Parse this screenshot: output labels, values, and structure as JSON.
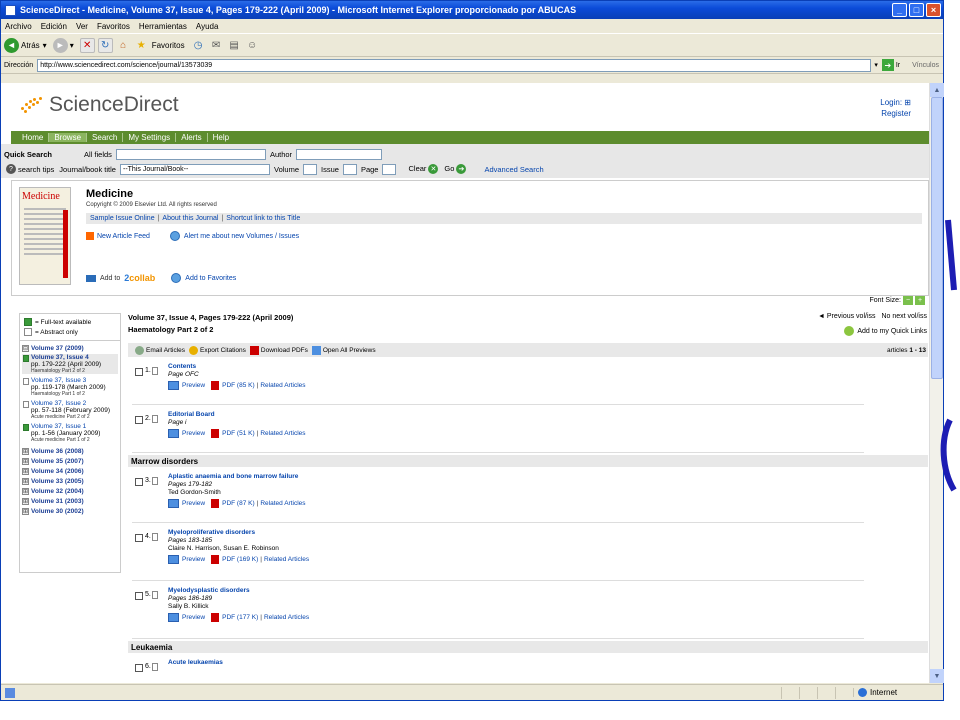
{
  "window": {
    "title": "ScienceDirect - Medicine, Volume 37, Issue 4, Pages 179-222 (April 2009) - Microsoft Internet Explorer proporcionado por ABUCAS"
  },
  "menu": [
    "Archivo",
    "Edición",
    "Ver",
    "Favoritos",
    "Herramientas",
    "Ayuda"
  ],
  "toolbar": {
    "back_label": "Atrás",
    "favorites_label": "Favoritos"
  },
  "address": {
    "label": "Dirección",
    "url": "http://www.sciencedirect.com/science/journal/13573039",
    "go_label": "Ir",
    "links_label": "Vínculos"
  },
  "site": {
    "logo_text": "ScienceDirect",
    "login": "Login:",
    "register": "Register"
  },
  "nav": [
    "Home",
    "Browse",
    "Search",
    "My Settings",
    "Alerts",
    "Help"
  ],
  "quick_search": {
    "label": "Quick Search",
    "all_fields": "All fields",
    "author": "Author",
    "search_tips": "search tips",
    "journal_title": "Journal/book title",
    "journal_value": "--This Journal/Book--",
    "volume": "Volume",
    "issue": "Issue",
    "page": "Page",
    "clear": "Clear",
    "go": "Go",
    "advanced": "Advanced Search"
  },
  "journal": {
    "cover_title": "Medicine",
    "title": "Medicine",
    "copyright": "Copyright © 2009 Elsevier Ltd. All rights reserved",
    "links": [
      "Sample Issue Online",
      "About this Journal",
      "Shortcut link to this Title"
    ],
    "feed": "New Article Feed",
    "alert": "Alert me about new Volumes / Issues",
    "add_to": "Add to",
    "collab_a": "2",
    "collab_b": "collab",
    "favorites": "Add to Favorites"
  },
  "font_size_label": "Font Size:",
  "legend": {
    "full_text": "= Full-text available",
    "abstract": "= Abstract only"
  },
  "volumes": [
    {
      "label": "Volume 37 (2009)",
      "sign": "⊟"
    },
    {
      "label": "Volume 36 (2008)",
      "sign": "⊞"
    },
    {
      "label": "Volume 35 (2007)",
      "sign": "⊞"
    },
    {
      "label": "Volume 34 (2006)",
      "sign": "⊞"
    },
    {
      "label": "Volume 33 (2005)",
      "sign": "⊞"
    },
    {
      "label": "Volume 32 (2004)",
      "sign": "⊞"
    },
    {
      "label": "Volume 31 (2003)",
      "sign": "⊞"
    },
    {
      "label": "Volume 30 (2002)",
      "sign": "⊞"
    }
  ],
  "issues": [
    {
      "name": "Volume 37, Issue 4",
      "pages": "pp. 179-222 (April 2009)",
      "sub": "Haematology Part 2 of 2"
    },
    {
      "name": "Volume 37, Issue 3",
      "pages": "pp. 119-178 (March 2009)",
      "sub": "Haematology Part 1 of 2"
    },
    {
      "name": "Volume 37, Issue 2",
      "pages": "pp. 57-118 (February 2009)",
      "sub": "Acute medicine Part 2 of 2"
    },
    {
      "name": "Volume 37, Issue 1",
      "pages": "pp. 1-56 (January 2009)",
      "sub": "Acute medicine Part 1 of 2"
    }
  ],
  "main": {
    "heading": "Volume 37, Issue 4, Pages 179-222 (April 2009)",
    "subheading": "Haematology Part 2 of 2",
    "prev": "◄ Previous vol/iss",
    "next": "No next vol/iss",
    "quick_links": "Add to my Quick Links",
    "actions": [
      "Email Articles",
      "Export Citations",
      "Download PDFs",
      "Open All Previews"
    ],
    "count_label": "articles",
    "count_value": "1 - 13"
  },
  "articles": [
    {
      "num": "1.",
      "title": "Contents",
      "pages": "Page OFC",
      "authors": "",
      "pdf": "PDF (85 K)"
    },
    {
      "num": "2.",
      "title": "Editorial Board",
      "pages": "Page i",
      "authors": "",
      "pdf": "PDF (51 K)"
    },
    {
      "num": "3.",
      "title": "Aplastic anaemia and bone marrow failure",
      "pages": "Pages 179-182",
      "authors": "Ted Gordon-Smith",
      "pdf": "PDF (87 K)"
    },
    {
      "num": "4.",
      "title": "Myeloproliferative disorders",
      "pages": "Pages 183-185",
      "authors": "Claire N. Harrison, Susan E. Robinson",
      "pdf": "PDF (169 K)"
    },
    {
      "num": "5.",
      "title": "Myelodysplastic disorders",
      "pages": "Pages 186-189",
      "authors": "Sally B. Killick",
      "pdf": "PDF (177 K)"
    },
    {
      "num": "6.",
      "title": "Acute leukaemias",
      "pages": "",
      "authors": "",
      "pdf": ""
    }
  ],
  "sections": {
    "marrow": "Marrow disorders",
    "leukaemia": "Leukaemia"
  },
  "article_links": {
    "preview": "Preview",
    "related": "Related Articles"
  },
  "status": {
    "zone": "Internet"
  }
}
